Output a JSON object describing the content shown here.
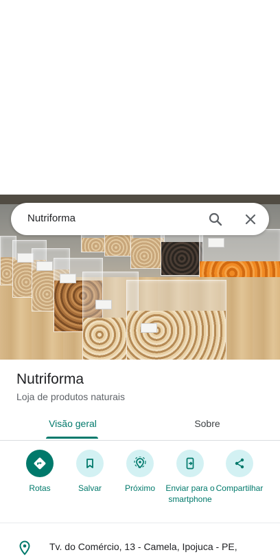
{
  "search": {
    "query": "Nutriforma"
  },
  "place": {
    "name": "Nutriforma",
    "category": "Loja de produtos naturais"
  },
  "tabs": [
    {
      "label": "Visão geral",
      "active": true
    },
    {
      "label": "Sobre",
      "active": false
    }
  ],
  "actions": [
    {
      "label": "Rotas",
      "icon": "directions-icon"
    },
    {
      "label": "Salvar",
      "icon": "bookmark-icon"
    },
    {
      "label": "Próximo",
      "icon": "nearby-icon"
    },
    {
      "label": "Enviar para o smartphone",
      "icon": "send-to-phone-icon"
    },
    {
      "label": "Compartilhar",
      "icon": "share-icon"
    }
  ],
  "address": {
    "text": "Tv. do Comércio, 13 - Camela, Ipojuca - PE,",
    "icon": "location-pin-icon"
  },
  "colors": {
    "accent": "#00796b",
    "action_bg": "#d3f1f3",
    "text_primary": "#202124",
    "text_secondary": "#5f6368"
  }
}
